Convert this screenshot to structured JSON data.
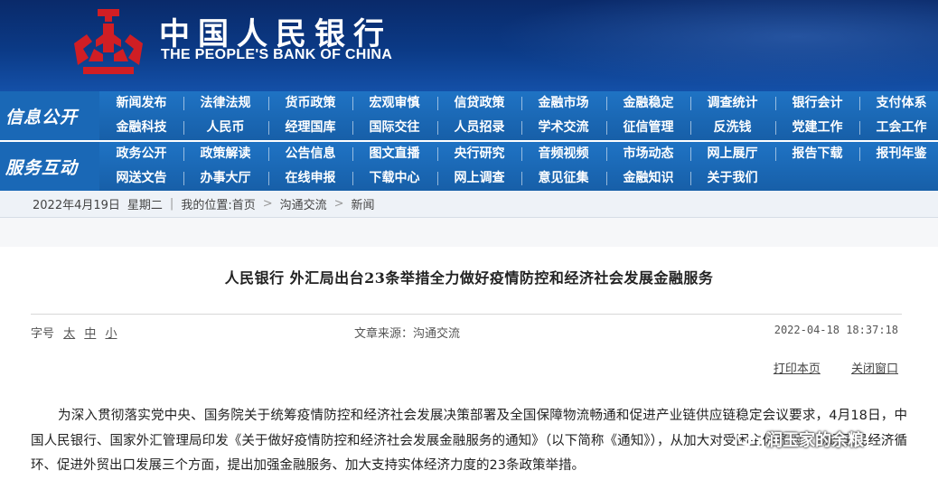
{
  "header": {
    "title_cn": "中国人民银行",
    "title_en": "THE PEOPLE'S BANK OF CHINA"
  },
  "nav": {
    "info_label": "信息公开",
    "service_label": "服务互动",
    "info_row1": [
      "新闻发布",
      "法律法规",
      "货币政策",
      "宏观审慎",
      "信贷政策",
      "金融市场",
      "金融稳定",
      "调查统计",
      "银行会计",
      "支付体系"
    ],
    "info_row2": [
      "金融科技",
      "人民币",
      "经理国库",
      "国际交往",
      "人员招录",
      "学术交流",
      "征信管理",
      "反洗钱",
      "党建工作",
      "工会工作"
    ],
    "service_row1": [
      "政务公开",
      "政策解读",
      "公告信息",
      "图文直播",
      "央行研究",
      "音频视频",
      "市场动态",
      "网上展厅",
      "报告下载",
      "报刊年鉴"
    ],
    "service_row2": [
      "网送文告",
      "办事大厅",
      "在线申报",
      "下载中心",
      "网上调查",
      "意见征集",
      "金融知识",
      "关于我们"
    ]
  },
  "breadcrumb": {
    "date": "2022年4月19日",
    "weekday": "星期二",
    "location_label": "我的位置:",
    "home": "首页",
    "section": "沟通交流",
    "page": "新闻"
  },
  "article": {
    "title": "人民银行 外汇局出台23条举措全力做好疫情防控和经济社会发展金融服务",
    "fontsize_label": "字号",
    "size_large": "太",
    "size_medium": "中",
    "size_small": "小",
    "source": "文章来源：沟通交流",
    "datetime": "2022-04-18 18:37:18",
    "print_label": "打印本页",
    "close_label": "关闭窗口",
    "body": "为深入贯彻落实党中央、国务院关于统筹疫情防控和经济社会发展决策部署及全国保障物流畅通和促进产业链供应链稳定会议要求，4月18日，中国人民银行、国家外汇管理局印发《关于做好疫情防控和经济社会发展金融服务的通知》（以下简称《通知》），从加大对受困主体纾困、畅通国民经济循环、促进外贸出口发展三个方面，提出加强金融服务、加大支持实体经济力度的23条政策举措。"
  },
  "watermark": {
    "text": "润玉家的余粮"
  },
  "colors": {
    "header_bg": "#0b3a86",
    "nav_bg": "#1f73c4",
    "logo_red": "#d01e24"
  }
}
